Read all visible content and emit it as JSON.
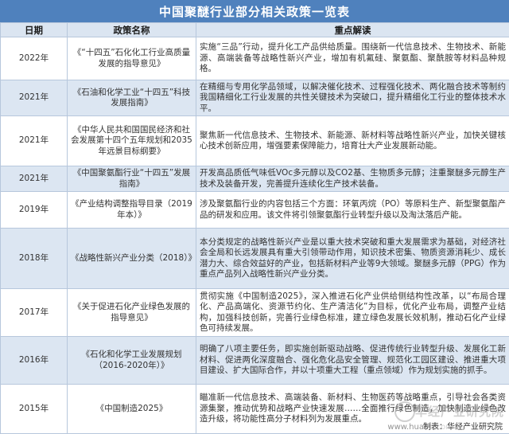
{
  "title": "中国聚醚行业部分相关政策一览表",
  "headers": [
    "日期",
    "政策名称",
    "重点解读"
  ],
  "rows": [
    {
      "date": "2022年",
      "name": "《“十四五”石化化工行业高质量发展的指导意见》",
      "point": "实施“三品”行动，提升化工产品供给质量。围绕新一代信息技术、生物技术、新能源、高端装备等战略性新兴产业，增加有机氟硅、聚氨酯、聚酰胺等材料品种规格。"
    },
    {
      "date": "2021年",
      "name": "《石油和化学工业“十四五”科技发展指南》",
      "point": "在精细与专用化学品领域，以解决催化技术、过程强化技术、两化融合技术等制约我国精细化工行业发展的共性关键技术为突破口，提升精细化工行业的整体技术水平。"
    },
    {
      "date": "2021年",
      "name": "《中华人民共和国国民经济和社会发展第十四个五年规划和2035年远景目标纲要》",
      "point": "聚焦新一代信息技术、生物技术、新能源、新材料等战略性新兴产业，加快关键核心技术创新应用，增强要素保障能力，培育壮大产业发展新动能。"
    },
    {
      "date": "2021年",
      "name": "《中国聚氨酯行业“十四五”发展指南》",
      "point": "开发高品质低气味低VOc多元醇以及CO2基、生物质多元醇；注重聚醚多元醇生产技术及装备开发，完善提升连续化生产技术装备。"
    },
    {
      "date": "2019年",
      "name": "《产业结构调整指导目录（2019年本）》",
      "point": "涉及聚氨酯行业的内容包括三个方面：环氧丙烷（PO）等原料生产、新型聚氨酯产品的研发和应用。该文件将引领聚氨酯行业转型升级以及淘汰落后产能。"
    },
    {
      "date": "2018年",
      "name": "《战略性新兴产业分类（2018）》",
      "point": "本分类规定的战略性新兴产业是以重大技术突破和重大发展需求为基础，对经济社会全局和长远发展具有重大引领带动作用，知识技术密集、物质资源消耗少、成长潜力大、综合效益好的产业，包括新材料产业等9大领域。聚醚多元醇（PPG）作为重点产品列入战略性新兴产业分类。"
    },
    {
      "date": "2017年",
      "name": "《关于促进石化产业绿色发展的指导意见》",
      "point": "贯彻实施《中国制造2025》，深入推进石化产业供给侧结构性改革，以“布局合理化、产品高端化、资源节约化、生产清洁化”为目标，优化产业布局，调整产业结构，加强科技创新，完善行业绿色标准，建立绿色发展长效机制，推动石化产业绿色可持续发展。"
    },
    {
      "date": "2016年",
      "name": "《石化和化学工业发展规划（2016-2020年）》",
      "point": "明确了八项主要任务，即实施创新驱动战略、促进传统行业转型升级、发展化工新材料、促进两化深度融合、强化危化品安全管理、规范化工园区建设、推进重大项目建设、扩大国际合作，并以十项重大工程（重点领域）作为规划实施的抓手。"
    },
    {
      "date": "2015年",
      "name": "《中国制造2025》",
      "point": "瞄准新一代信息技术、高端装备、新材料、生物医药等战略重点，引导社会各类资源集聚，推动优势和战略产业快速发展……全面推行绿色制造，加快制造业绿色改造升级，将功能性高分子材料列为发展重点。"
    }
  ],
  "source": "制表：华经产业研究院",
  "watermark": {
    "text": "华经产业研究院",
    "url": "www.huaon.com"
  }
}
